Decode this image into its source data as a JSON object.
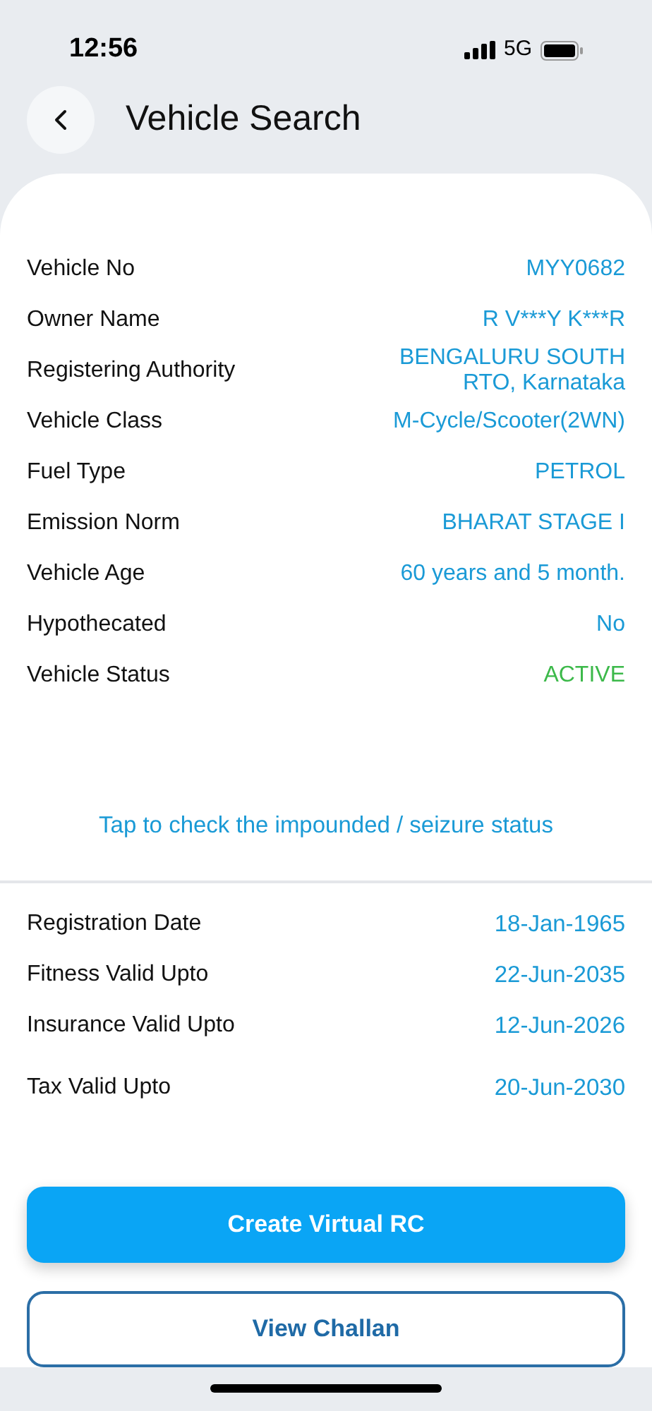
{
  "status_bar": {
    "time": "12:56",
    "network": "5G"
  },
  "header": {
    "title": "Vehicle Search"
  },
  "details": [
    {
      "label": "Vehicle No",
      "value": "MYY0682",
      "kind": "text"
    },
    {
      "label": "Owner Name",
      "value": "R V***Y K***R",
      "kind": "text"
    },
    {
      "label": "Registering Authority",
      "value": "BENGALURU SOUTH RTO, Karnataka",
      "kind": "text"
    },
    {
      "label": "Vehicle Class",
      "value": "M-Cycle/Scooter(2WN)",
      "kind": "text"
    },
    {
      "label": "Fuel Type",
      "value": "PETROL",
      "kind": "text"
    },
    {
      "label": "Emission Norm",
      "value": "BHARAT STAGE I",
      "kind": "text"
    },
    {
      "label": "Vehicle Age",
      "value": "60 years and 5 month.",
      "kind": "text"
    },
    {
      "label": "Hypothecated",
      "value": "No",
      "kind": "text"
    },
    {
      "label": "Vehicle Status",
      "value": "ACTIVE",
      "kind": "status"
    }
  ],
  "seizure_link": "Tap to check the impounded / seizure status",
  "dates": [
    {
      "label": "Registration Date",
      "value": "18-Jan-1965"
    },
    {
      "label": "Fitness Valid Upto",
      "value": "22-Jun-2035"
    },
    {
      "label": "Insurance Valid Upto",
      "value": "12-Jun-2026"
    },
    {
      "label": "Tax Valid Upto",
      "value": "20-Jun-2030"
    }
  ],
  "buttons": [
    {
      "label": "Create Virtual RC",
      "kind": "primary"
    },
    {
      "label": "View Challan",
      "kind": "outline"
    }
  ]
}
